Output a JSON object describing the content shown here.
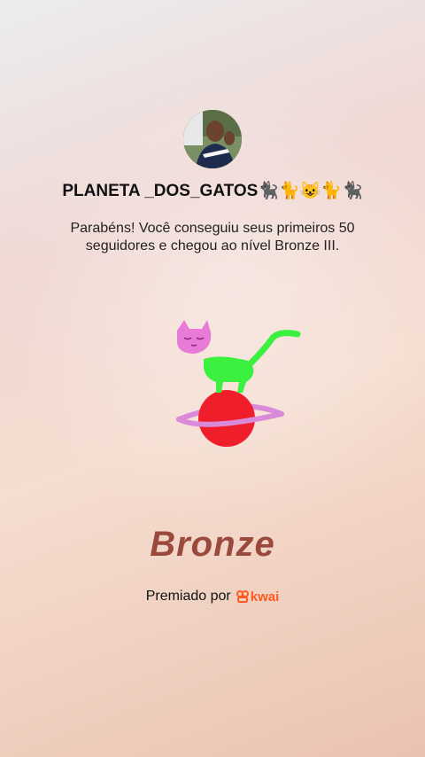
{
  "profile": {
    "name": "PLANETA _DOS_GATOS🐈‍⬛🐈😺🐈🐈‍⬛"
  },
  "message": "Parabéns! Você conseguiu seus primeiros 50 seguidores e chegou ao nível Bronze III.",
  "level": "Bronze",
  "award": {
    "label": "Premiado por",
    "brand": "kwai",
    "brand_color": "#ff5a1f"
  },
  "colors": {
    "level_text": "#9a4a3c",
    "cat_head": "#e87ad8",
    "cat_body": "#3cf040",
    "planet": "#f01e2a",
    "ring": "#d98ad8"
  }
}
